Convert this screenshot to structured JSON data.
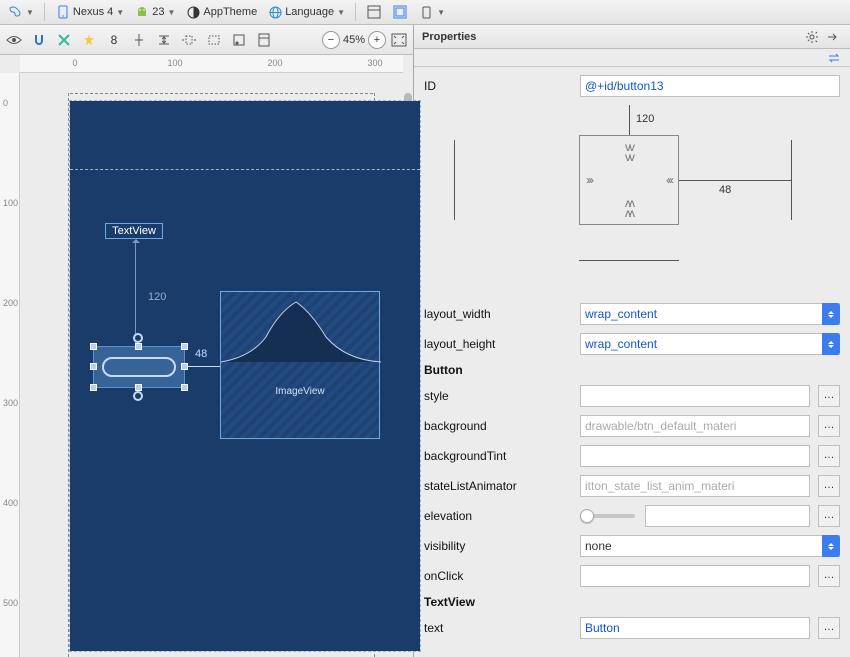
{
  "topbar": {
    "device": "Nexus 4",
    "api": "23",
    "theme": "AppTheme",
    "language": "Language"
  },
  "canvas": {
    "zoom": "45%",
    "ruler_h": [
      "0",
      "100",
      "200",
      "300"
    ],
    "ruler_v": [
      "0",
      "100",
      "200",
      "300",
      "400",
      "500"
    ],
    "textview_label": "TextView",
    "imageview_label": "ImageView",
    "constraint_top": "120",
    "constraint_right": "48"
  },
  "panel": {
    "title": "Properties",
    "id_label": "ID",
    "id_value": "@+id/button13",
    "constraint_top": "120",
    "constraint_right": "48",
    "layout_width_label": "layout_width",
    "layout_width_value": "wrap_content",
    "layout_height_label": "layout_height",
    "layout_height_value": "wrap_content",
    "section_button": "Button",
    "style_label": "style",
    "style_value": "",
    "background_label": "background",
    "background_hint": "drawable/btn_default_materi",
    "backgroundTint_label": "backgroundTint",
    "stateListAnimator_label": "stateListAnimator",
    "stateListAnimator_hint": "itton_state_list_anim_materi",
    "elevation_label": "elevation",
    "visibility_label": "visibility",
    "visibility_value": "none",
    "onClick_label": "onClick",
    "section_textview": "TextView",
    "text_label": "text",
    "text_value": "Button"
  }
}
